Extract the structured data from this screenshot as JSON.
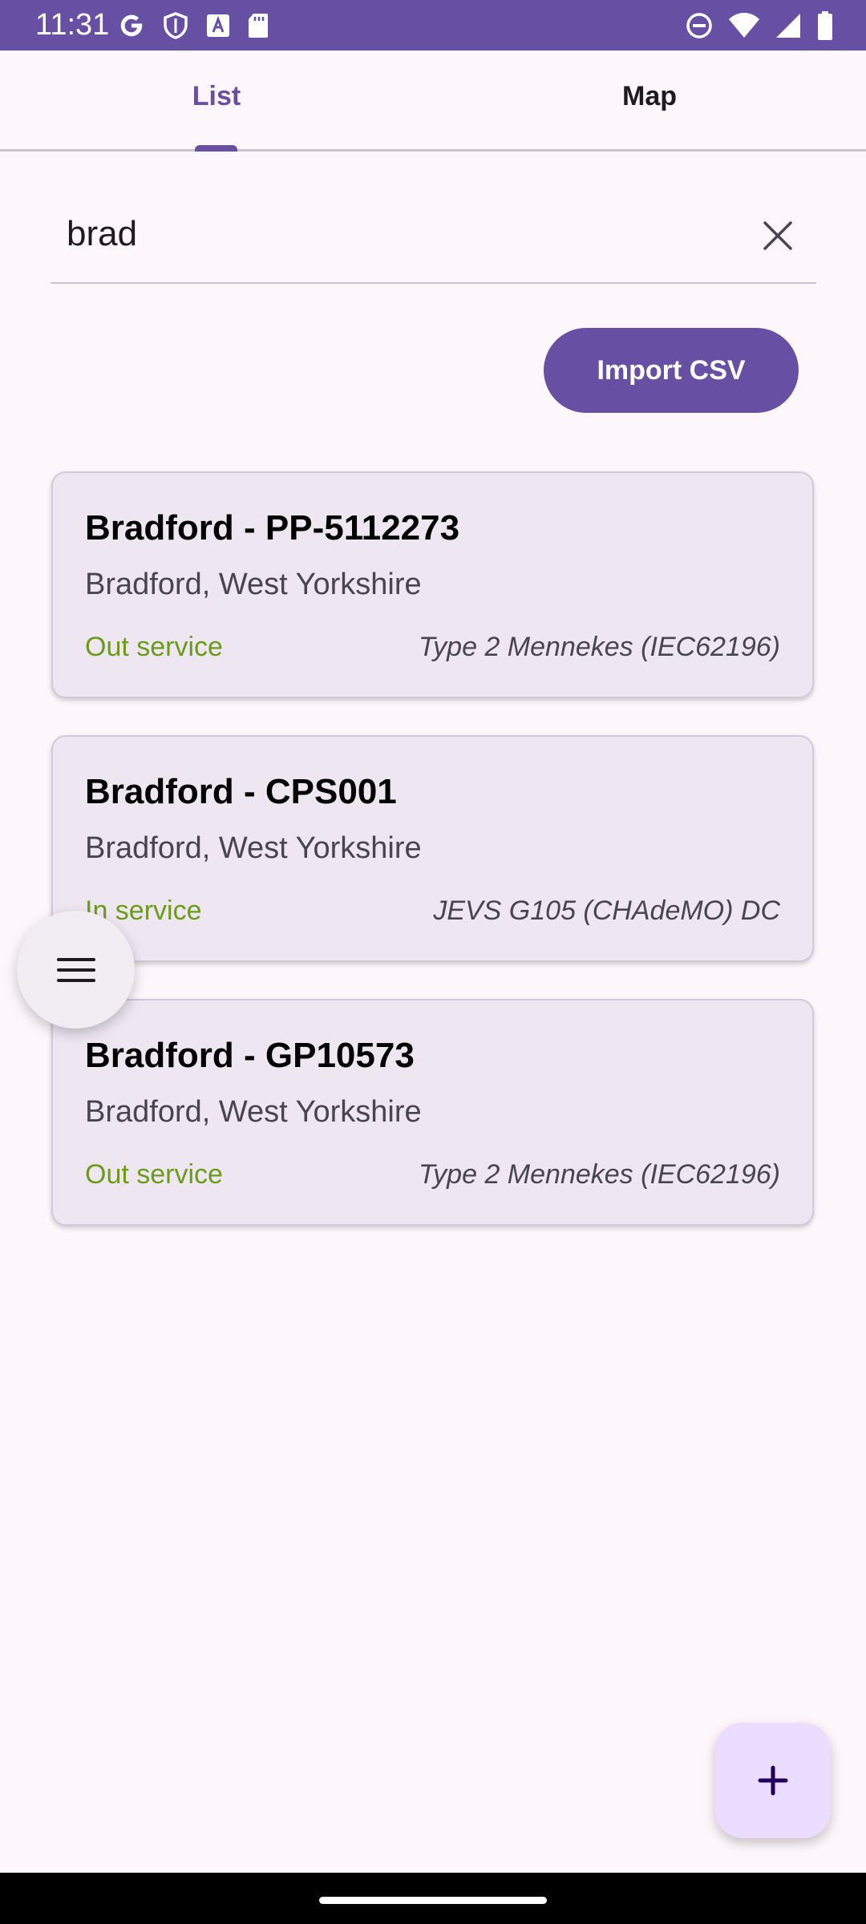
{
  "status_bar": {
    "time": "11:31",
    "left_icons": [
      "google-icon",
      "shield-icon",
      "font-icon",
      "sd-card-icon"
    ],
    "right_icons": [
      "do-not-disturb-icon",
      "wifi-icon",
      "signal-icon",
      "battery-icon"
    ]
  },
  "tabs": [
    {
      "label": "List",
      "selected": true
    },
    {
      "label": "Map",
      "selected": false
    }
  ],
  "search": {
    "value": "brad",
    "placeholder": ""
  },
  "import_button": {
    "label": "Import CSV"
  },
  "stations": [
    {
      "title": "Bradford - PP-5112273",
      "location": "Bradford, West Yorkshire",
      "status": "Out service",
      "connector": "Type 2 Mennekes (IEC62196)"
    },
    {
      "title": "Bradford - CPS001",
      "location": "Bradford, West Yorkshire",
      "status": "In service",
      "connector": "JEVS G105 (CHAdeMO) DC"
    },
    {
      "title": "Bradford - GP10573",
      "location": "Bradford, West Yorkshire",
      "status": "Out service",
      "connector": "Type 2 Mennekes (IEC62196)"
    }
  ],
  "colors": {
    "primary": "#6750a4",
    "status_green": "#6a9c18",
    "card_background": "#eee7f2",
    "page_background": "#fdf7fc",
    "fab_background": "#eaddff"
  },
  "icons": {
    "clear": "close-icon",
    "menu": "hamburger-menu-icon",
    "add": "plus-icon"
  }
}
